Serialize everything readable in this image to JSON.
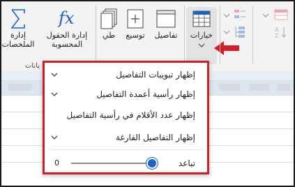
{
  "ribbon": {
    "buttons": [
      {
        "id": "subtotals",
        "label_line1": "إدارة",
        "label_line2": "الملخصات"
      },
      {
        "id": "calculated",
        "label_line1": "إدارة الحقول",
        "label_line2": "المحسوبة"
      },
      {
        "id": "collapse",
        "label": "طي"
      },
      {
        "id": "expand",
        "label": "توسيع"
      },
      {
        "id": "details",
        "label": "تفاصيل"
      },
      {
        "id": "options",
        "label": "خيارات"
      }
    ],
    "group_label": "يانات"
  },
  "menu": {
    "items": [
      {
        "label": "إظهار تبويبات التفاصيل",
        "has_chevron": true
      },
      {
        "label": "إظهار رأسية أعمدة التفاصيل",
        "has_chevron": true
      },
      {
        "label": "إظهار عدد الأقلام في رأسية التفاصيل",
        "has_chevron": false
      },
      {
        "label": "إظهار التفاصيل الفارغة",
        "has_chevron": true
      }
    ],
    "slider": {
      "label": "تباعد",
      "min_label": "0",
      "value_fraction": 1.0
    }
  },
  "colors": {
    "highlight_border": "#d11f26",
    "arrow": "#d11f26",
    "slider_thumb": "#1a64c8",
    "icon_blue": "#1a64c8"
  }
}
